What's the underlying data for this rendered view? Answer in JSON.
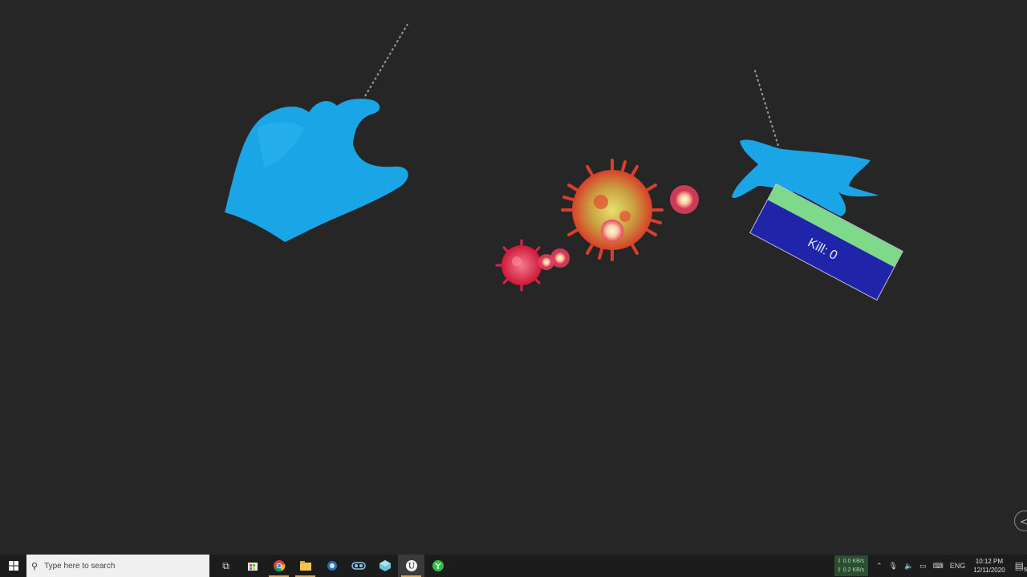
{
  "hud": {
    "kill_label": "Kill: 0",
    "kill_bar_color": "#7ed98a",
    "kill_panel_color": "#1f24a8"
  },
  "scene": {
    "hand_color": "#1aa6e6",
    "virus_large_color": "#d96a2a",
    "virus_small_color": "#e03050"
  },
  "taskbar": {
    "search_placeholder": "Type here to search",
    "pinned": [
      {
        "name": "task-view-icon",
        "glyph": "▯"
      },
      {
        "name": "store-icon",
        "glyph": "🛍"
      },
      {
        "name": "chrome-icon",
        "glyph": "◉"
      },
      {
        "name": "file-explorer-icon",
        "glyph": "▆"
      },
      {
        "name": "app-globe-icon",
        "glyph": "●"
      },
      {
        "name": "vr-headset-icon",
        "glyph": "⊂⊃"
      },
      {
        "name": "app-cube-icon",
        "glyph": "◆"
      },
      {
        "name": "unreal-engine-icon",
        "glyph": "U"
      },
      {
        "name": "app-green-icon",
        "glyph": "●"
      }
    ],
    "net_down": "⇩ 0.0 KB/s",
    "net_up": "⇧ 0.2 KB/s",
    "language": "ENG",
    "time": "10:12 PM",
    "date": "12/11/2020",
    "notification_count": "5"
  }
}
